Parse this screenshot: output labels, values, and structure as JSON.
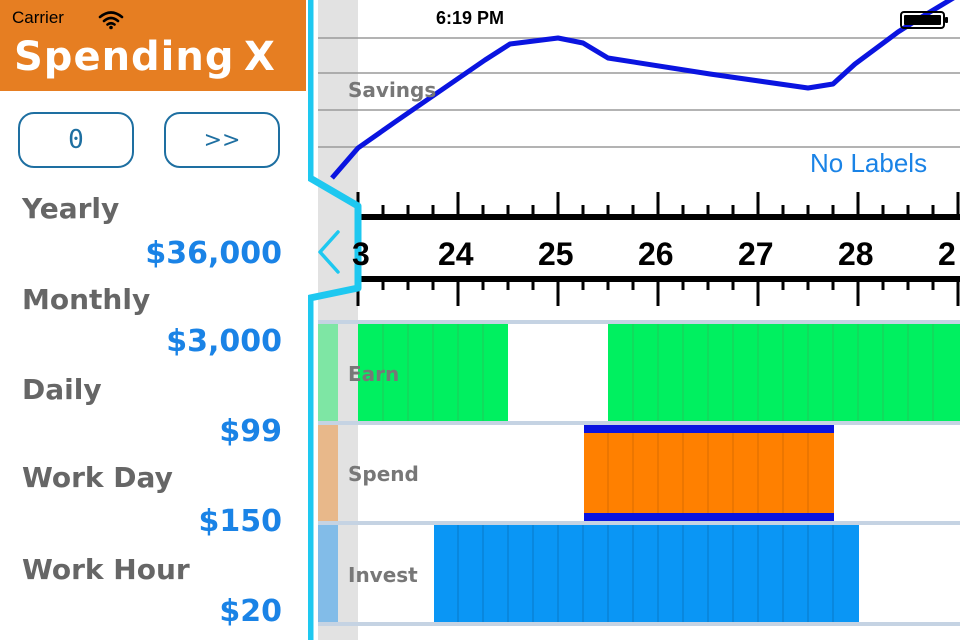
{
  "status_bar": {
    "carrier": "Carrier",
    "time": "6:19 PM"
  },
  "panel": {
    "title": "Spending",
    "close_label": "X",
    "buttons": {
      "zero": "0",
      "next": ">>"
    },
    "stats": [
      {
        "label": "Yearly",
        "value": "$36,000"
      },
      {
        "label": "Monthly",
        "value": "$3,000"
      },
      {
        "label": "Daily",
        "value": "$99"
      },
      {
        "label": "Work Day",
        "value": "$150"
      },
      {
        "label": "Work Hour",
        "value": "$20"
      }
    ]
  },
  "chart": {
    "savings_label": "Savings",
    "no_labels": "No Labels",
    "days": [
      "3",
      "24",
      "25",
      "26",
      "27",
      "28",
      "2"
    ],
    "rows": {
      "earn": "Earn",
      "spend": "Spend",
      "invest": "Invest"
    }
  },
  "colors": {
    "header": "#E67E22",
    "accent_blue": "#1A83E6",
    "pill_border": "#1E6FA1",
    "earn": "#00F060",
    "spend": "#FF8000",
    "invest": "#0A96F5",
    "line": "#0A14E0",
    "panel_border": "#1EC8F0"
  }
}
